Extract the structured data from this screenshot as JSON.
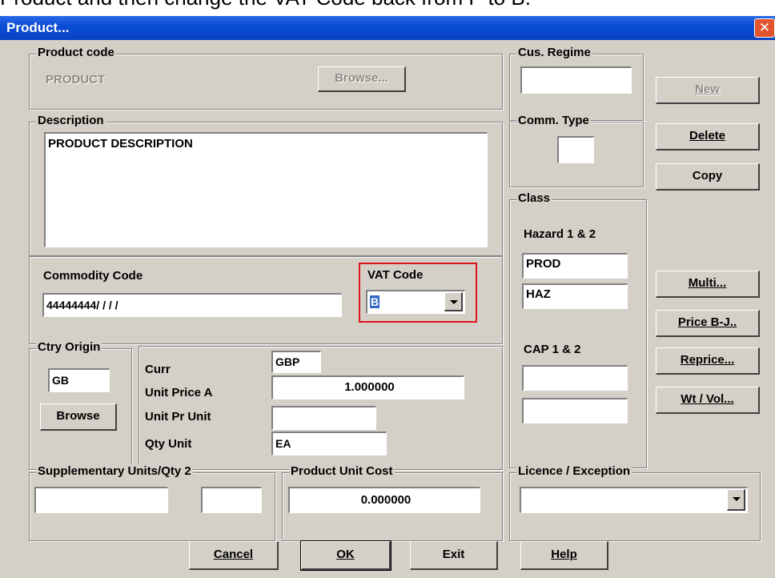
{
  "caption": "Product and then change the VAT Code back from P to B.",
  "window": {
    "title": "Product...",
    "close_glyph": "✕"
  },
  "product_code": {
    "group_label": "Product code",
    "value": "PRODUCT",
    "browse_label": "Browse..."
  },
  "description": {
    "group_label": "Description",
    "value": "PRODUCT DESCRIPTION"
  },
  "commodity": {
    "label": "Commodity Code",
    "value": "44444444/ /  /  /"
  },
  "vat": {
    "label": "VAT Code",
    "value": "B"
  },
  "ctry_origin": {
    "group_label": "Ctry Origin",
    "value": "GB",
    "browse_label": "Browse"
  },
  "pricing": {
    "curr_label": "Curr",
    "curr_value": "GBP",
    "unit_price_label": "Unit Price A",
    "unit_price_value": "1.000000",
    "unit_pr_unit_label": "Unit Pr Unit",
    "unit_pr_unit_value": "",
    "qty_unit_label": "Qty Unit",
    "qty_unit_value": "EA"
  },
  "supplementary": {
    "group_label": "Supplementary Units/Qty 2",
    "value1": "",
    "value2": ""
  },
  "unit_cost": {
    "group_label": "Product Unit Cost",
    "value": "0.000000"
  },
  "cus_regime": {
    "group_label": "Cus. Regime",
    "value": ""
  },
  "comm_type": {
    "group_label": "Comm. Type",
    "value": ""
  },
  "class": {
    "group_label": "Class",
    "hazard_label": "Hazard 1 & 2",
    "hazard1": "PROD",
    "hazard2": "HAZ",
    "cap_label": "CAP  1 & 2",
    "cap1": "",
    "cap2": ""
  },
  "licence": {
    "group_label": "Licence / Exception",
    "value": ""
  },
  "side_buttons": {
    "new": "New",
    "delete": "Delete",
    "copy": "Copy",
    "multi": "Multi...",
    "price_bj": "Price B-J..",
    "reprice": "Reprice...",
    "wt_vol": "Wt / Vol..."
  },
  "bottom_buttons": {
    "cancel": "Cancel",
    "ok": "OK",
    "exit": "Exit",
    "help": "Help"
  },
  "colors": {
    "title_bar": "#0a4ed6",
    "dialog_bg": "#d4d0c8",
    "highlight_box": "#e0141e",
    "close_button": "#e2542e"
  }
}
